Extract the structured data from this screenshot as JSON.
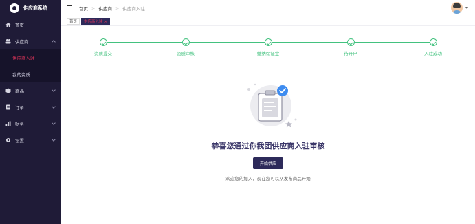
{
  "brand": {
    "title": "供应商系统"
  },
  "sidebar": {
    "items": [
      {
        "label": "首页",
        "icon": "home-icon"
      },
      {
        "label": "供应商",
        "icon": "supplier-icon",
        "expandable": true,
        "expanded": true,
        "children": [
          {
            "label": "供应商入驻",
            "active": true
          },
          {
            "label": "我的资质"
          }
        ]
      },
      {
        "label": "商品",
        "icon": "goods-icon",
        "expandable": true
      },
      {
        "label": "订单",
        "icon": "order-icon",
        "expandable": true
      },
      {
        "label": "财务",
        "icon": "finance-icon",
        "expandable": true
      },
      {
        "label": "设置",
        "icon": "settings-icon",
        "expandable": true
      }
    ]
  },
  "header": {
    "breadcrumb": [
      "首页",
      "供应商",
      "供应商入驻"
    ]
  },
  "tags": [
    {
      "label": "首页",
      "active": false
    },
    {
      "label": "供应商入驻",
      "active": true,
      "close": "×"
    }
  ],
  "steps": [
    {
      "label": "资质提交"
    },
    {
      "label": "资质审核"
    },
    {
      "label": "缴纳保证金"
    },
    {
      "label": "待开户"
    },
    {
      "label": "入驻成功"
    }
  ],
  "main": {
    "congrats": "恭喜您通过你我团供应商入驻审核",
    "start_button": "开始供应",
    "welcome": "欢迎您的加入，现在您可以从发布商品开始"
  },
  "colors": {
    "sidebar_bg": "#1f1b37",
    "accent": "#2d2a5a",
    "active_text": "#e0355a",
    "step_green": "#43c27f"
  }
}
